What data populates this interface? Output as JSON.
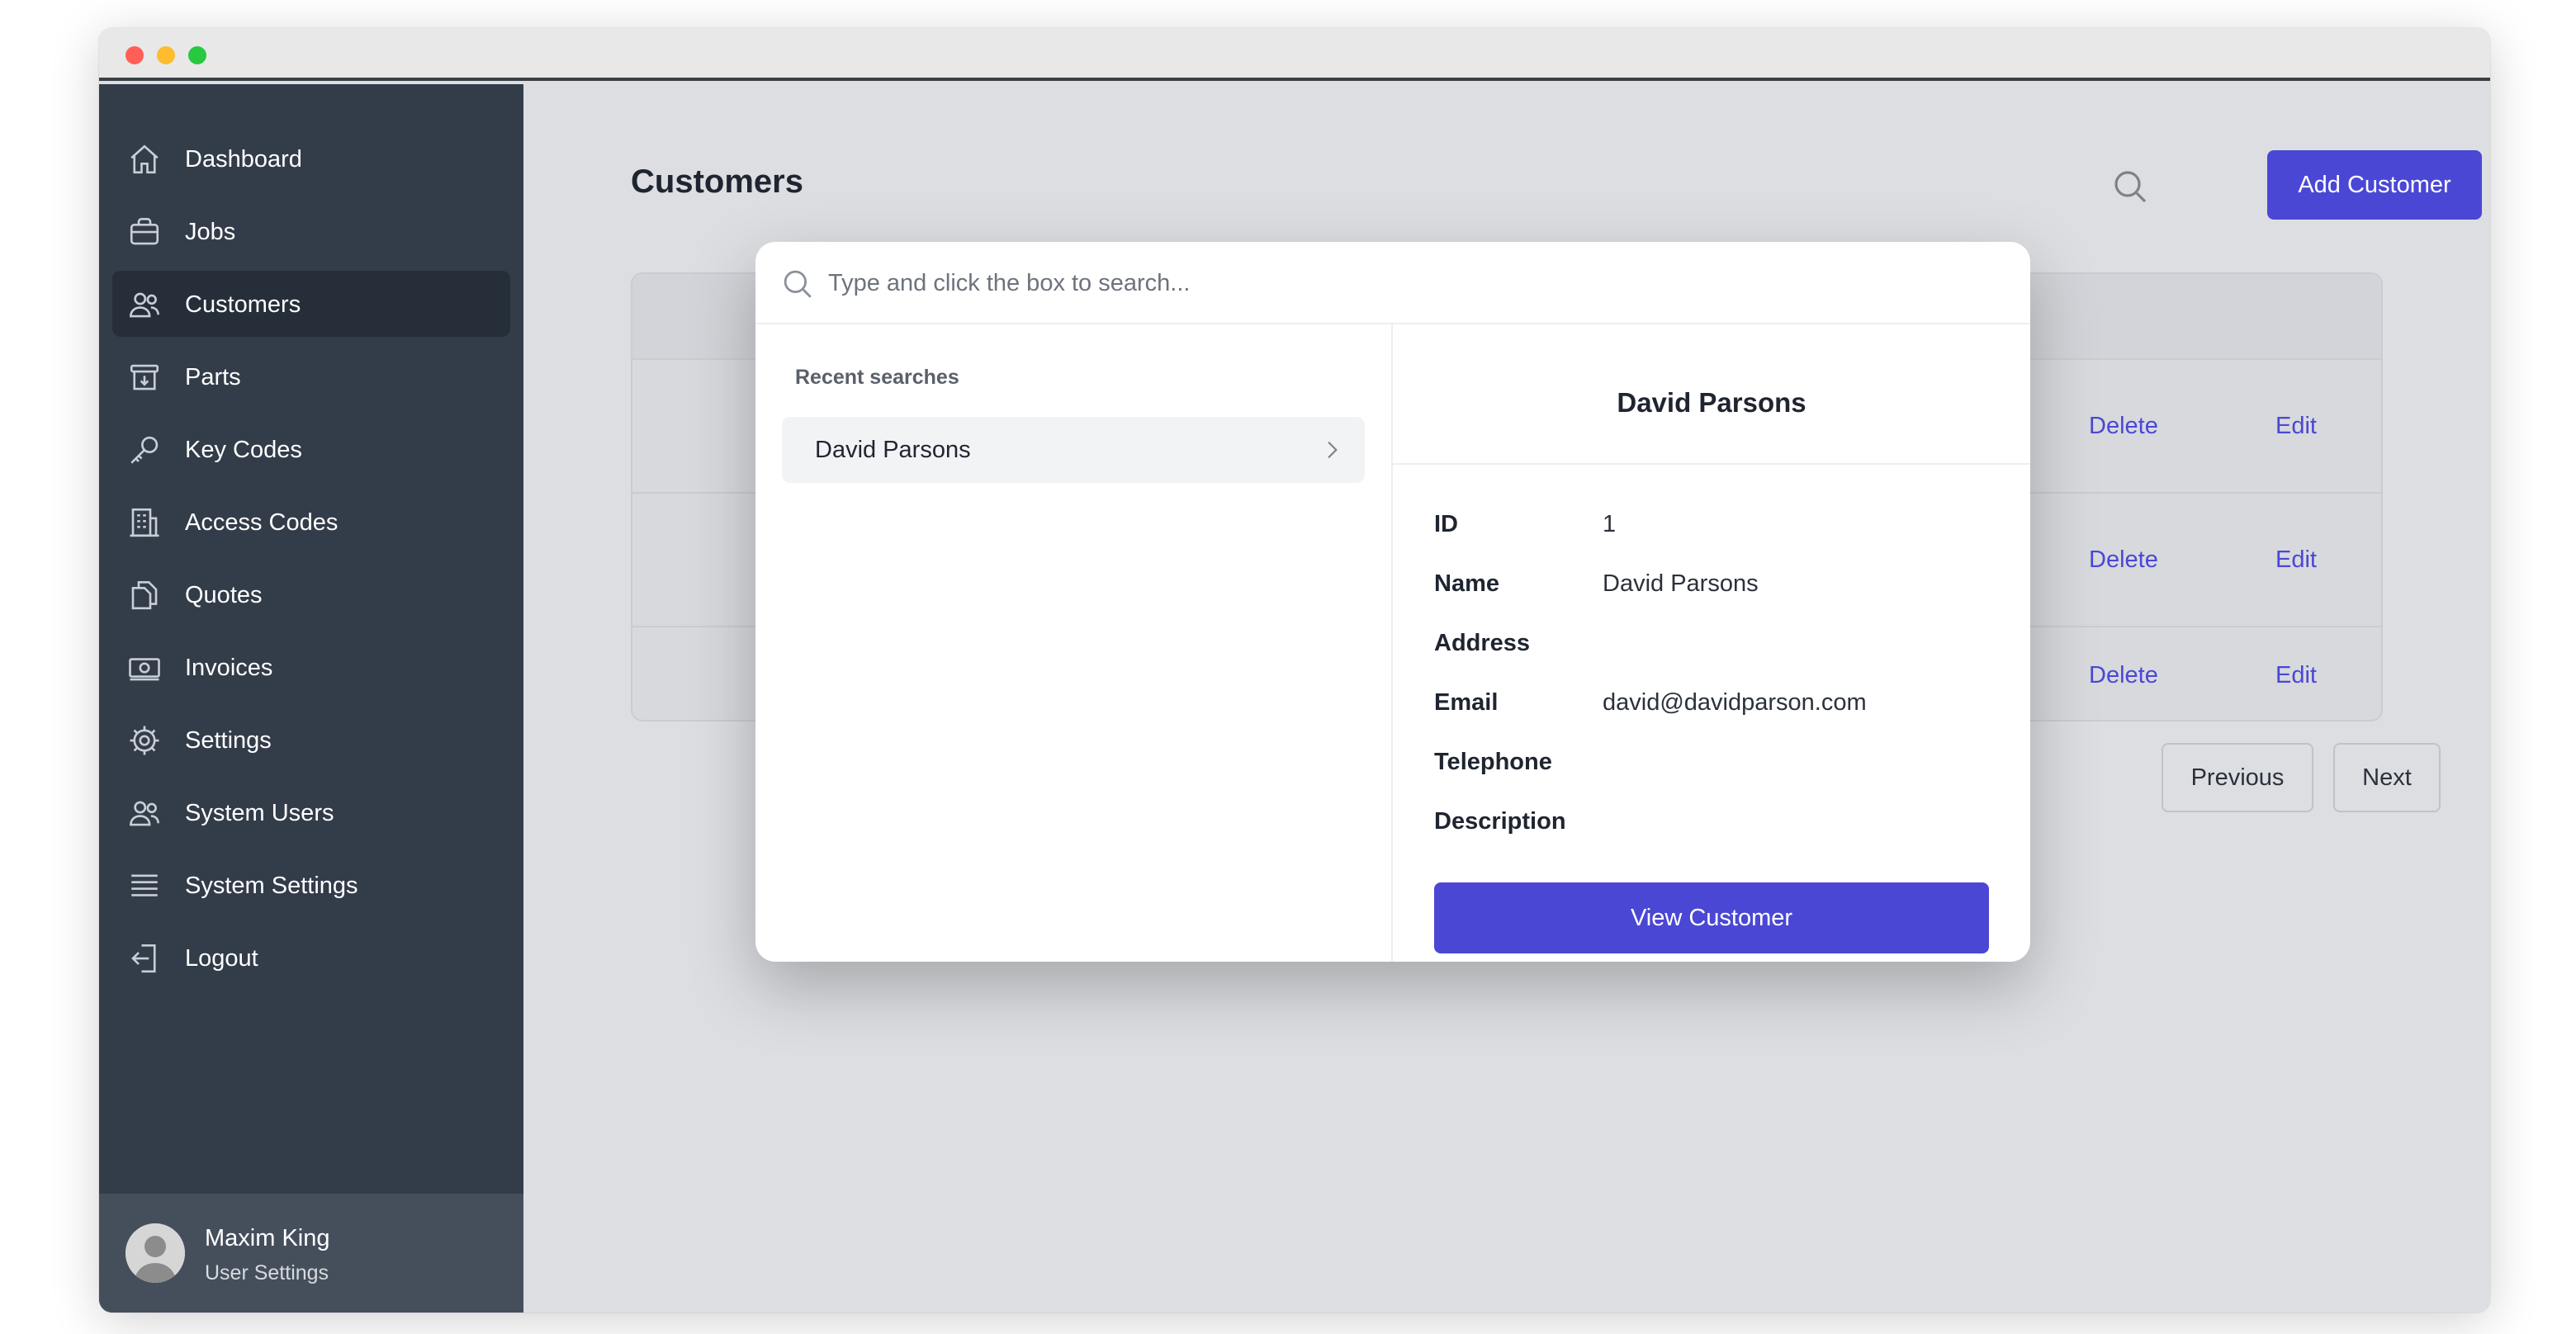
{
  "sidebar": {
    "items": [
      {
        "label": "Dashboard",
        "icon": "home-icon"
      },
      {
        "label": "Jobs",
        "icon": "briefcase-icon"
      },
      {
        "label": "Customers",
        "icon": "users-icon",
        "active": true
      },
      {
        "label": "Parts",
        "icon": "archive-icon"
      },
      {
        "label": "Key Codes",
        "icon": "key-icon"
      },
      {
        "label": "Access Codes",
        "icon": "building-icon"
      },
      {
        "label": "Quotes",
        "icon": "documents-icon"
      },
      {
        "label": "Invoices",
        "icon": "cash-icon"
      },
      {
        "label": "Settings",
        "icon": "cog-icon"
      },
      {
        "label": "System Users",
        "icon": "users-icon"
      },
      {
        "label": "System Settings",
        "icon": "list-icon"
      },
      {
        "label": "Logout",
        "icon": "logout-icon"
      }
    ],
    "user": {
      "name": "Maxim King",
      "settings_label": "User Settings"
    }
  },
  "main": {
    "title": "Customers",
    "add_button": "Add Customer",
    "rows": [
      {
        "delete": "Delete",
        "edit": "Edit"
      },
      {
        "delete": "Delete",
        "edit": "Edit"
      },
      {
        "delete": "Delete",
        "edit": "Edit"
      }
    ],
    "pagination": {
      "previous": "Previous",
      "next": "Next"
    }
  },
  "modal": {
    "search_placeholder": "Type and click the box to search...",
    "recent_title": "Recent searches",
    "recent_items": [
      "David Parsons"
    ],
    "detail": {
      "name": "David Parsons",
      "fields": [
        {
          "label": "ID",
          "value": "1"
        },
        {
          "label": "Name",
          "value": "David Parsons"
        },
        {
          "label": "Address",
          "value": ""
        },
        {
          "label": "Email",
          "value": "david@davidparson.com"
        },
        {
          "label": "Telephone",
          "value": ""
        },
        {
          "label": "Description",
          "value": ""
        }
      ],
      "view_button": "View Customer"
    }
  },
  "colors": {
    "sidebar_bg": "#333c49",
    "sidebar_active": "#262e3a",
    "accent": "#4b47d5",
    "main_bg": "#dcdee2"
  }
}
